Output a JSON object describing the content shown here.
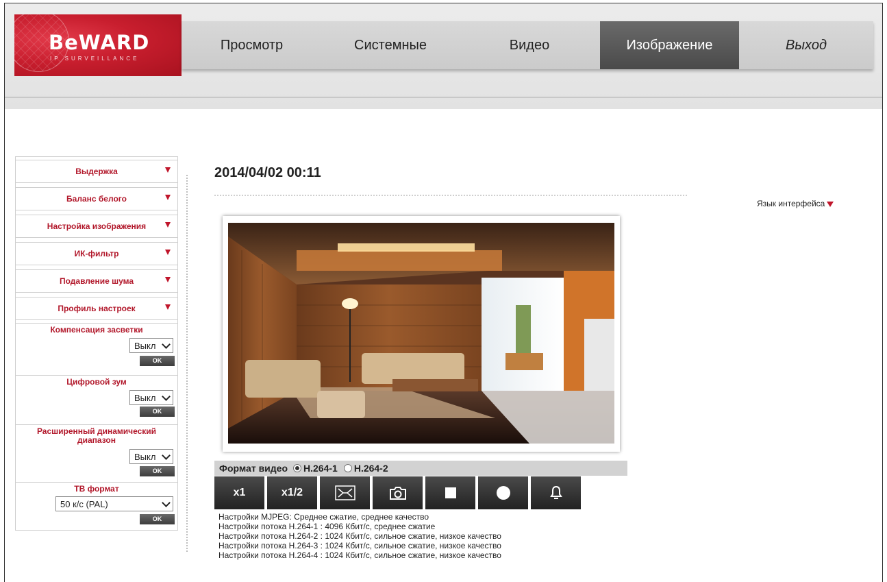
{
  "brand": {
    "name": "BeWARD",
    "tagline": "IP SURVEILLANCE",
    "color": "#c81e2e"
  },
  "nav": {
    "items": [
      {
        "label": "Просмотр",
        "active": false
      },
      {
        "label": "Системные",
        "active": false
      },
      {
        "label": "Видео",
        "active": false
      },
      {
        "label": "Изображение",
        "active": true
      },
      {
        "label": "Выход",
        "active": false
      }
    ]
  },
  "sidebar": {
    "menu": [
      {
        "label": "Выдержка"
      },
      {
        "label": "Баланс белого"
      },
      {
        "label": "Настройка изображения"
      },
      {
        "label": "ИК-фильтр"
      },
      {
        "label": "Подавление шума"
      },
      {
        "label": "Профиль настроек"
      }
    ],
    "backlight": {
      "title": "Компенсация засветки",
      "value": "Выкл",
      "ok": "OK"
    },
    "digital_zoom": {
      "title": "Цифровой зум",
      "value": "Выкл",
      "ok": "OK"
    },
    "wdr": {
      "title_line1": "Расширенный динамический",
      "title_line2": "диапазон",
      "value": "Выкл",
      "ok": "OK"
    },
    "tv_format": {
      "title": "ТВ формат",
      "value": "50 к/с (PAL)",
      "ok": "OK"
    }
  },
  "main": {
    "datetime": "2014/04/02 00:11",
    "language_label": "Язык интерфейса",
    "format": {
      "label": "Формат видео",
      "options": [
        {
          "label": "H.264-1",
          "selected": true
        },
        {
          "label": "H.264-2",
          "selected": false
        }
      ]
    },
    "controls": {
      "x1": "x1",
      "x_half": "x1/2"
    },
    "info": [
      "Настройки MJPEG: Среднее сжатие, среднее качество",
      "Настройки потока H.264-1 : 4096 Кбит/с, среднее сжатие",
      "Настройки потока H.264-2 : 1024 Кбит/с, сильное сжатие, низкое качество",
      "Настройки потока H.264-3 : 1024 Кбит/с, сильное сжатие, низкое качество",
      "Настройки потока H.264-4 : 1024 Кбит/с, сильное сжатие, низкое качество"
    ]
  },
  "colors": {
    "accent_red": "#b2182b",
    "nav_active": "#555555",
    "button_dark": "#333333"
  }
}
